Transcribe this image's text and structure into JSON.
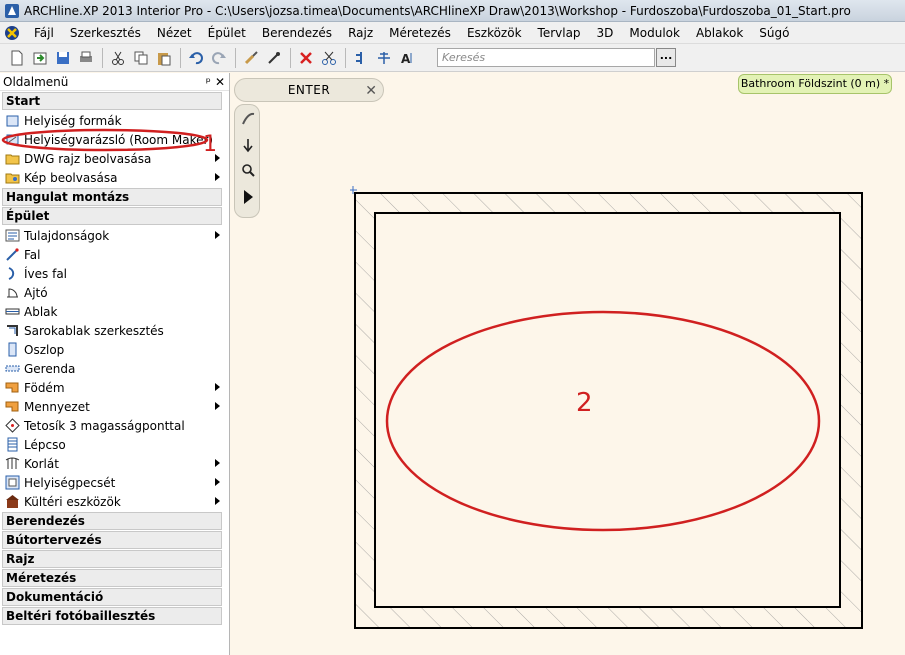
{
  "window": {
    "title": "ARCHline.XP 2013 Interior Pro - C:\\Users\\jozsa.timea\\Documents\\ARCHlineXP Draw\\2013\\Workshop - Furdoszoba\\Furdoszoba_01_Start.pro"
  },
  "menubar": {
    "items": [
      "Fájl",
      "Szerkesztés",
      "Nézet",
      "Épület",
      "Berendezés",
      "Rajz",
      "Méretezés",
      "Eszközök",
      "Tervlap",
      "3D",
      "Modulok",
      "Ablakok",
      "Súgó"
    ]
  },
  "toolbar": {
    "search_placeholder": "Keresés",
    "search_button_label": "...",
    "icons": [
      "new-icon",
      "open-icon",
      "save-icon",
      "print-icon",
      "cut-icon",
      "copy-icon",
      "paste-icon",
      "undo-icon",
      "redo-icon",
      "brush-icon",
      "eyedropper-icon",
      "delete-icon",
      "scissors-icon",
      "align-icon",
      "grid-icon",
      "text-icon"
    ]
  },
  "sidebar": {
    "title": "Oldalmenü",
    "pin_label": "ᵖ",
    "close_label": "✕",
    "sections": [
      {
        "label": "Start",
        "items": [
          {
            "label": "Helyiség formák",
            "icon": "room-shape-icon",
            "submenu": false
          },
          {
            "label": "Helyiségvarázsló (Room Maker)",
            "icon": "room-maker-icon",
            "submenu": false
          },
          {
            "label": "DWG rajz beolvasása",
            "icon": "dwg-import-icon",
            "submenu": true
          },
          {
            "label": "Kép beolvasása",
            "icon": "image-import-icon",
            "submenu": true
          }
        ]
      },
      {
        "label": "Hangulat montázs",
        "items": []
      },
      {
        "label": "Épület",
        "items": [
          {
            "label": "Tulajdonságok",
            "icon": "properties-icon",
            "submenu": true
          },
          {
            "label": "Fal",
            "icon": "wall-icon",
            "submenu": false
          },
          {
            "label": "Íves fal",
            "icon": "curved-wall-icon",
            "submenu": false
          },
          {
            "label": "Ajtó",
            "icon": "door-icon",
            "submenu": false
          },
          {
            "label": "Ablak",
            "icon": "window-icon",
            "submenu": false
          },
          {
            "label": "Sarokablak szerkesztés",
            "icon": "corner-window-icon",
            "submenu": false
          },
          {
            "label": "Oszlop",
            "icon": "column-icon",
            "submenu": false
          },
          {
            "label": "Gerenda",
            "icon": "beam-icon",
            "submenu": false
          },
          {
            "label": "Födém",
            "icon": "slab-icon",
            "submenu": true
          },
          {
            "label": "Mennyezet",
            "icon": "ceiling-icon",
            "submenu": true
          },
          {
            "label": "Tetosík 3 magasságponttal",
            "icon": "roof-plane-icon",
            "submenu": false
          },
          {
            "label": "Lépcso",
            "icon": "stair-icon",
            "submenu": false
          },
          {
            "label": "Korlát",
            "icon": "railing-icon",
            "submenu": true
          },
          {
            "label": "Helyiségpecsét",
            "icon": "room-stamp-icon",
            "submenu": true
          },
          {
            "label": "Kültéri eszközök",
            "icon": "outdoor-tools-icon",
            "submenu": true
          }
        ]
      },
      {
        "label": "Berendezés",
        "items": []
      },
      {
        "label": "Bútortervezés",
        "items": []
      },
      {
        "label": "Rajz",
        "items": []
      },
      {
        "label": "Méretezés",
        "items": []
      },
      {
        "label": "Dokumentáció",
        "items": []
      },
      {
        "label": "Beltéri fotóbaillesztés",
        "items": []
      }
    ]
  },
  "command_bar": {
    "label": "ENTER",
    "close_label": "✕"
  },
  "vertical_toolbar": {
    "icons": [
      "pen-icon",
      "arrow-down-icon",
      "zoom-icon",
      "play-icon"
    ]
  },
  "status_tab": {
    "label": "Bathroom Földszint (0 m) *"
  },
  "annotations": {
    "marker_1": "1",
    "marker_2": "2"
  },
  "colors": {
    "annotation_red": "#d02020",
    "status_tab_bg": "#e3f2b5",
    "canvas_bg": "#fdf6ea"
  }
}
